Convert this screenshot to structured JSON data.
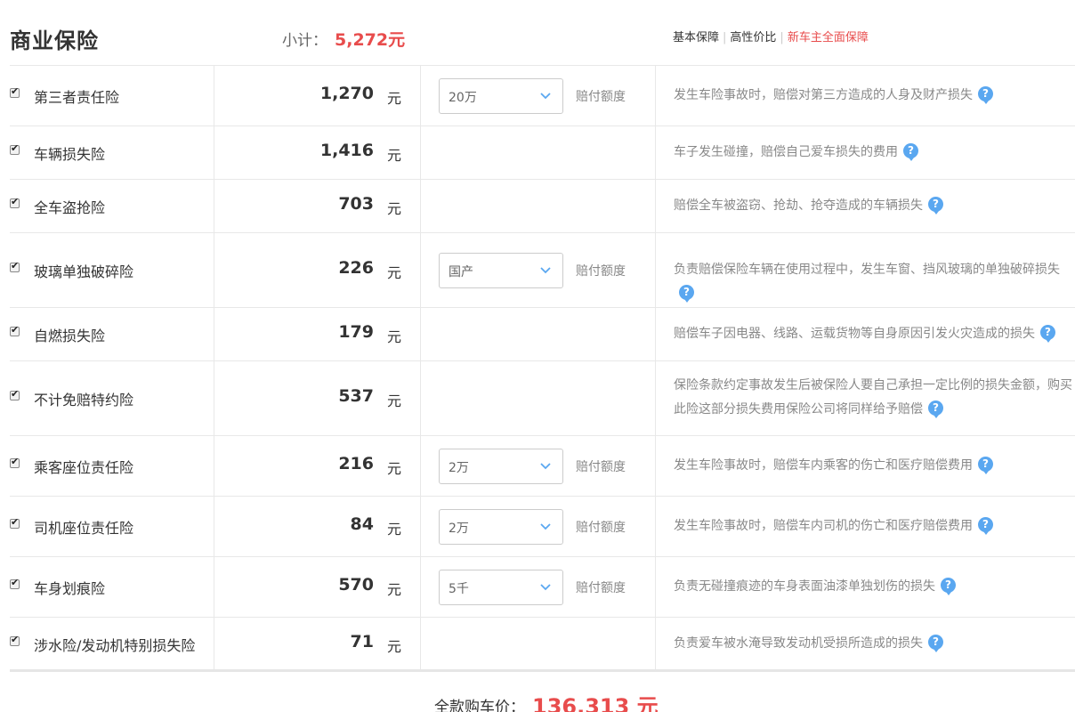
{
  "header": {
    "title": "商业保险",
    "subtotal_label": "小计：",
    "subtotal_value": "5,272元",
    "plans": [
      "基本保障",
      "高性价比",
      "新车主全面保障"
    ]
  },
  "rows": [
    {
      "name": "第三者责任险",
      "price": "1,270",
      "unit": "元",
      "select": "20万",
      "pay_label": "赔付额度",
      "desc": "发生车险事故时，赔偿对第三方造成的人身及财产损失",
      "checked": true
    },
    {
      "name": "车辆损失险",
      "price": "1,416",
      "unit": "元",
      "desc": "车子发生碰撞，赔偿自己爱车损失的费用",
      "checked": true
    },
    {
      "name": "全车盗抢险",
      "price": "703",
      "unit": "元",
      "desc": "赔偿全车被盗窃、抢劫、抢夺造成的车辆损失",
      "checked": true
    },
    {
      "name": "玻璃单独破碎险",
      "price": "226",
      "unit": "元",
      "select": "国产",
      "pay_label": "赔付额度",
      "desc": "负责赔偿保险车辆在使用过程中，发生车窗、挡风玻璃的单独破碎损失",
      "checked": true
    },
    {
      "name": "自燃损失险",
      "price": "179",
      "unit": "元",
      "desc": "赔偿车子因电器、线路、运载货物等自身原因引发火灾造成的损失",
      "checked": true
    },
    {
      "name": "不计免赔特约险",
      "price": "537",
      "unit": "元",
      "desc": "保险条款约定事故发生后被保险人要自己承担一定比例的损失金额，购买此险这部分损失费用保险公司将同样给予赔偿",
      "checked": true
    },
    {
      "name": "乘客座位责任险",
      "price": "216",
      "unit": "元",
      "select": "2万",
      "pay_label": "赔付额度",
      "desc": "发生车险事故时，赔偿车内乘客的伤亡和医疗赔偿费用",
      "checked": true
    },
    {
      "name": "司机座位责任险",
      "price": "84",
      "unit": "元",
      "select": "2万",
      "pay_label": "赔付额度",
      "desc": "发生车险事故时，赔偿车内司机的伤亡和医疗赔偿费用",
      "checked": true
    },
    {
      "name": "车身划痕险",
      "price": "570",
      "unit": "元",
      "select": "5千",
      "pay_label": "赔付额度",
      "desc": "负责无碰撞痕迹的车身表面油漆单独划伤的损失",
      "checked": true
    },
    {
      "name": "涉水险/发动机特别损失险",
      "price": "71",
      "unit": "元",
      "desc": "负责爱车被水淹导致发动机受损所造成的损失",
      "checked": true
    }
  ],
  "help_icon": "?",
  "footer": {
    "total_label": "全款购车价：",
    "total_value": "136,313 元"
  },
  "colors": {
    "accent": "#e84c4c",
    "help": "#5aa7f0"
  }
}
